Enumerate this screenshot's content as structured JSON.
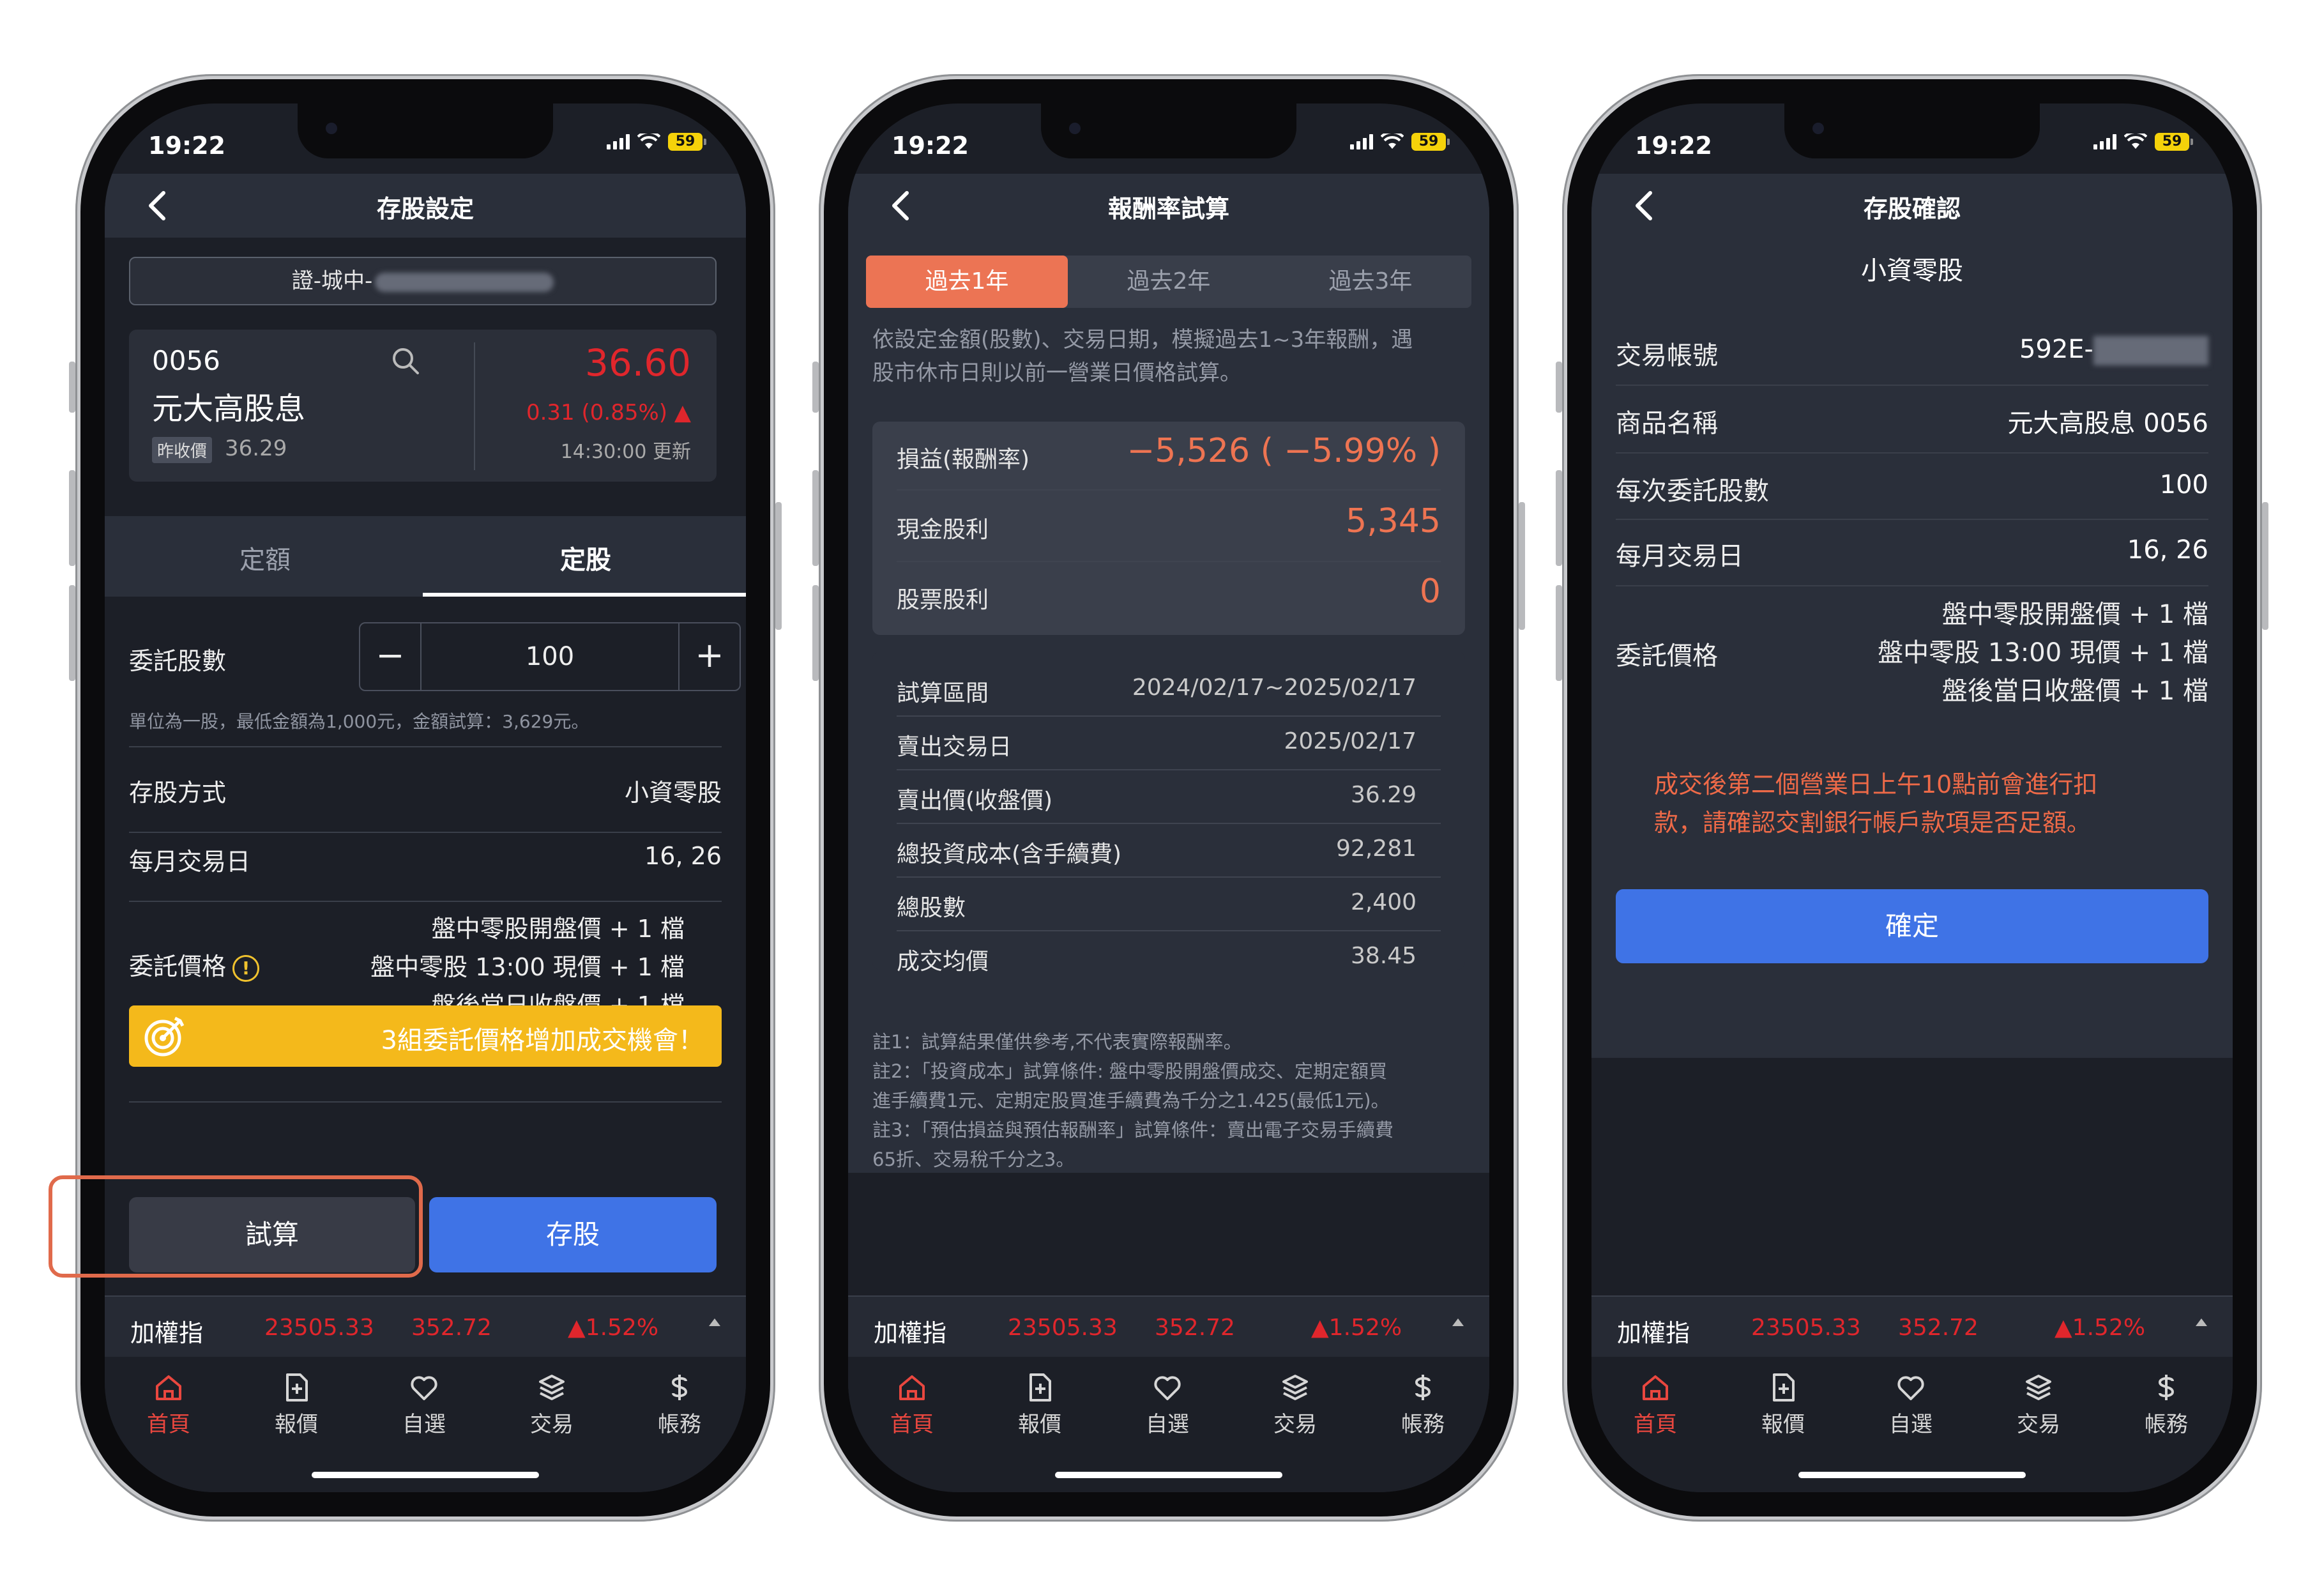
{
  "status_bar": {
    "time": "19:22",
    "battery": "59"
  },
  "ticker": {
    "name": "加權指",
    "value": "23505.33",
    "change": "352.72",
    "percent": "▲1.52%"
  },
  "tabbar": {
    "items": [
      {
        "label": "首頁",
        "icon": "home-icon"
      },
      {
        "label": "報價",
        "icon": "quote-doc-icon"
      },
      {
        "label": "自選",
        "icon": "heart-icon"
      },
      {
        "label": "交易",
        "icon": "layers-icon"
      },
      {
        "label": "帳務",
        "icon": "dollar-icon"
      }
    ],
    "active_color": "#e9473f"
  },
  "screen1": {
    "title": "存股設定",
    "account_prefix": "證-城中-",
    "quote": {
      "code": "0056",
      "name": "元大高股息",
      "prev_label": "昨收價",
      "prev": "36.29",
      "price": "36.60",
      "change": "0.31 (0.85%) ▲",
      "updated": "14:30:00 更新"
    },
    "tabs": [
      "定額",
      "定股"
    ],
    "shares_label": "委託股數",
    "shares_value": "100",
    "minus": "−",
    "plus": "+",
    "hint": "單位為一股，最低金額為1,000元，金額試算：3,629元。",
    "method_label": "存股方式",
    "method_value": "小資零股",
    "day_label": "每月交易日",
    "day_value": "16, 26",
    "price_label": "委託價格",
    "price_warn": "!",
    "price_lines": [
      "盤中零股開盤價 + 1 檔",
      "盤中零股 13:00 現價 + 1 檔",
      "盤後當日收盤價 + 1 檔"
    ],
    "banner": "3組委託價格增加成交機會！",
    "btn_calc": "試算",
    "btn_save": "存股",
    "colors": {
      "highlight": "#e06a4b",
      "primary": "#3f73e6",
      "banner": "#f4b91b",
      "red": "#e0262c"
    }
  },
  "screen2": {
    "title": "報酬率試算",
    "tabs": [
      "過去1年",
      "過去2年",
      "過去3年"
    ],
    "desc": [
      "依設定金額(股數)、交易日期，模擬過去1~3年報酬，遇",
      "股市休市日則以前一營業日價格試算。"
    ],
    "summary": [
      {
        "label": "損益(報酬率)",
        "value": "−5,526 ( −5.99% )"
      },
      {
        "label": "現金股利",
        "value": "5,345"
      },
      {
        "label": "股票股利",
        "value": "0"
      }
    ],
    "details": [
      {
        "label": "試算區間",
        "value": "2024/02/17~2025/02/17"
      },
      {
        "label": "賣出交易日",
        "value": "2025/02/17"
      },
      {
        "label": "賣出價(收盤價)",
        "value": "36.29"
      },
      {
        "label": "總投資成本(含手續費)",
        "value": "92,281"
      },
      {
        "label": "總股數",
        "value": "2,400"
      },
      {
        "label": "成交均價",
        "value": "38.45"
      }
    ],
    "notes": [
      "註1：試算結果僅供參考,不代表實際報酬率。",
      "註2：「投資成本」試算條件: 盤中零股開盤價成交、定期定額買",
      "進手續費1元、定期定股買進手續費為千分之1.425(最低1元)。",
      "註3：「預估損益與預估報酬率」試算條件：賣出電子交易手續費",
      "65折、交易稅千分之3。"
    ]
  },
  "screen3": {
    "title": "存股確認",
    "subtitle": "小資零股",
    "rows": [
      {
        "label": "交易帳號",
        "value": "592E-"
      },
      {
        "label": "商品名稱",
        "value": "元大高股息 0056"
      },
      {
        "label": "每次委託股數",
        "value": "100"
      },
      {
        "label": "每月交易日",
        "value": "16, 26"
      }
    ],
    "price_label": "委託價格",
    "price_lines": [
      "盤中零股開盤價 + 1 檔",
      "盤中零股 13:00 現價 + 1 檔",
      "盤後當日收盤價 + 1 檔"
    ],
    "warning": [
      "成交後第二個營業日上午10點前會進行扣",
      "款，請確認交割銀行帳戶款項是否足額。"
    ],
    "confirm": "確定"
  }
}
